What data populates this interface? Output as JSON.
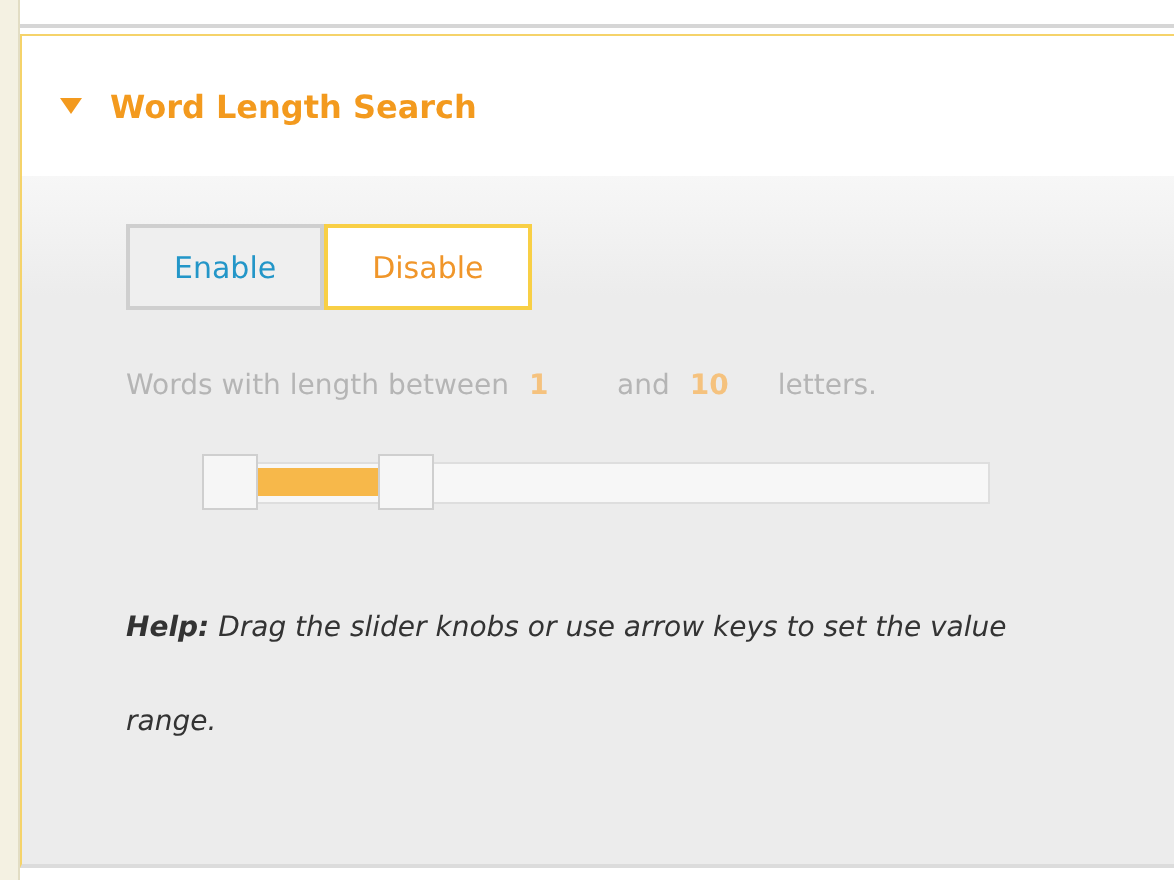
{
  "section": {
    "title": "Word Length Search",
    "expanded": true
  },
  "toggle": [
    {
      "label": "Enable",
      "selected": false
    },
    {
      "label": "Disable",
      "selected": true
    }
  ],
  "range_text": {
    "prefix": "Words with length between",
    "min": "1",
    "middle": "and",
    "max": "10",
    "suffix": "letters."
  },
  "slider": {
    "knobs": [
      {
        "level": 0
      },
      {
        "level": 0.24
      }
    ]
  },
  "help": "**Help:** Drag the slider knobs or use arrow keys to set the value range."
}
